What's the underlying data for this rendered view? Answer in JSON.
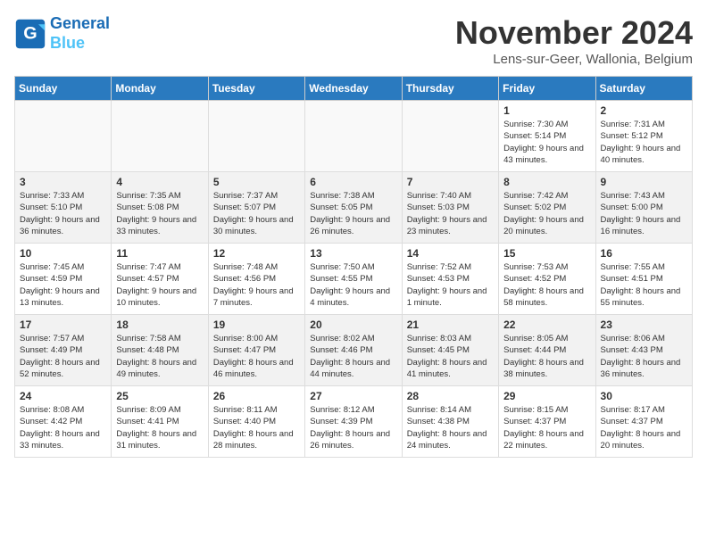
{
  "header": {
    "logo_line1": "General",
    "logo_line2": "Blue",
    "title": "November 2024",
    "location": "Lens-sur-Geer, Wallonia, Belgium"
  },
  "weekdays": [
    "Sunday",
    "Monday",
    "Tuesday",
    "Wednesday",
    "Thursday",
    "Friday",
    "Saturday"
  ],
  "weeks": [
    [
      {
        "day": "",
        "info": ""
      },
      {
        "day": "",
        "info": ""
      },
      {
        "day": "",
        "info": ""
      },
      {
        "day": "",
        "info": ""
      },
      {
        "day": "",
        "info": ""
      },
      {
        "day": "1",
        "info": "Sunrise: 7:30 AM\nSunset: 5:14 PM\nDaylight: 9 hours and 43 minutes."
      },
      {
        "day": "2",
        "info": "Sunrise: 7:31 AM\nSunset: 5:12 PM\nDaylight: 9 hours and 40 minutes."
      }
    ],
    [
      {
        "day": "3",
        "info": "Sunrise: 7:33 AM\nSunset: 5:10 PM\nDaylight: 9 hours and 36 minutes."
      },
      {
        "day": "4",
        "info": "Sunrise: 7:35 AM\nSunset: 5:08 PM\nDaylight: 9 hours and 33 minutes."
      },
      {
        "day": "5",
        "info": "Sunrise: 7:37 AM\nSunset: 5:07 PM\nDaylight: 9 hours and 30 minutes."
      },
      {
        "day": "6",
        "info": "Sunrise: 7:38 AM\nSunset: 5:05 PM\nDaylight: 9 hours and 26 minutes."
      },
      {
        "day": "7",
        "info": "Sunrise: 7:40 AM\nSunset: 5:03 PM\nDaylight: 9 hours and 23 minutes."
      },
      {
        "day": "8",
        "info": "Sunrise: 7:42 AM\nSunset: 5:02 PM\nDaylight: 9 hours and 20 minutes."
      },
      {
        "day": "9",
        "info": "Sunrise: 7:43 AM\nSunset: 5:00 PM\nDaylight: 9 hours and 16 minutes."
      }
    ],
    [
      {
        "day": "10",
        "info": "Sunrise: 7:45 AM\nSunset: 4:59 PM\nDaylight: 9 hours and 13 minutes."
      },
      {
        "day": "11",
        "info": "Sunrise: 7:47 AM\nSunset: 4:57 PM\nDaylight: 9 hours and 10 minutes."
      },
      {
        "day": "12",
        "info": "Sunrise: 7:48 AM\nSunset: 4:56 PM\nDaylight: 9 hours and 7 minutes."
      },
      {
        "day": "13",
        "info": "Sunrise: 7:50 AM\nSunset: 4:55 PM\nDaylight: 9 hours and 4 minutes."
      },
      {
        "day": "14",
        "info": "Sunrise: 7:52 AM\nSunset: 4:53 PM\nDaylight: 9 hours and 1 minute."
      },
      {
        "day": "15",
        "info": "Sunrise: 7:53 AM\nSunset: 4:52 PM\nDaylight: 8 hours and 58 minutes."
      },
      {
        "day": "16",
        "info": "Sunrise: 7:55 AM\nSunset: 4:51 PM\nDaylight: 8 hours and 55 minutes."
      }
    ],
    [
      {
        "day": "17",
        "info": "Sunrise: 7:57 AM\nSunset: 4:49 PM\nDaylight: 8 hours and 52 minutes."
      },
      {
        "day": "18",
        "info": "Sunrise: 7:58 AM\nSunset: 4:48 PM\nDaylight: 8 hours and 49 minutes."
      },
      {
        "day": "19",
        "info": "Sunrise: 8:00 AM\nSunset: 4:47 PM\nDaylight: 8 hours and 46 minutes."
      },
      {
        "day": "20",
        "info": "Sunrise: 8:02 AM\nSunset: 4:46 PM\nDaylight: 8 hours and 44 minutes."
      },
      {
        "day": "21",
        "info": "Sunrise: 8:03 AM\nSunset: 4:45 PM\nDaylight: 8 hours and 41 minutes."
      },
      {
        "day": "22",
        "info": "Sunrise: 8:05 AM\nSunset: 4:44 PM\nDaylight: 8 hours and 38 minutes."
      },
      {
        "day": "23",
        "info": "Sunrise: 8:06 AM\nSunset: 4:43 PM\nDaylight: 8 hours and 36 minutes."
      }
    ],
    [
      {
        "day": "24",
        "info": "Sunrise: 8:08 AM\nSunset: 4:42 PM\nDaylight: 8 hours and 33 minutes."
      },
      {
        "day": "25",
        "info": "Sunrise: 8:09 AM\nSunset: 4:41 PM\nDaylight: 8 hours and 31 minutes."
      },
      {
        "day": "26",
        "info": "Sunrise: 8:11 AM\nSunset: 4:40 PM\nDaylight: 8 hours and 28 minutes."
      },
      {
        "day": "27",
        "info": "Sunrise: 8:12 AM\nSunset: 4:39 PM\nDaylight: 8 hours and 26 minutes."
      },
      {
        "day": "28",
        "info": "Sunrise: 8:14 AM\nSunset: 4:38 PM\nDaylight: 8 hours and 24 minutes."
      },
      {
        "day": "29",
        "info": "Sunrise: 8:15 AM\nSunset: 4:37 PM\nDaylight: 8 hours and 22 minutes."
      },
      {
        "day": "30",
        "info": "Sunrise: 8:17 AM\nSunset: 4:37 PM\nDaylight: 8 hours and 20 minutes."
      }
    ]
  ]
}
